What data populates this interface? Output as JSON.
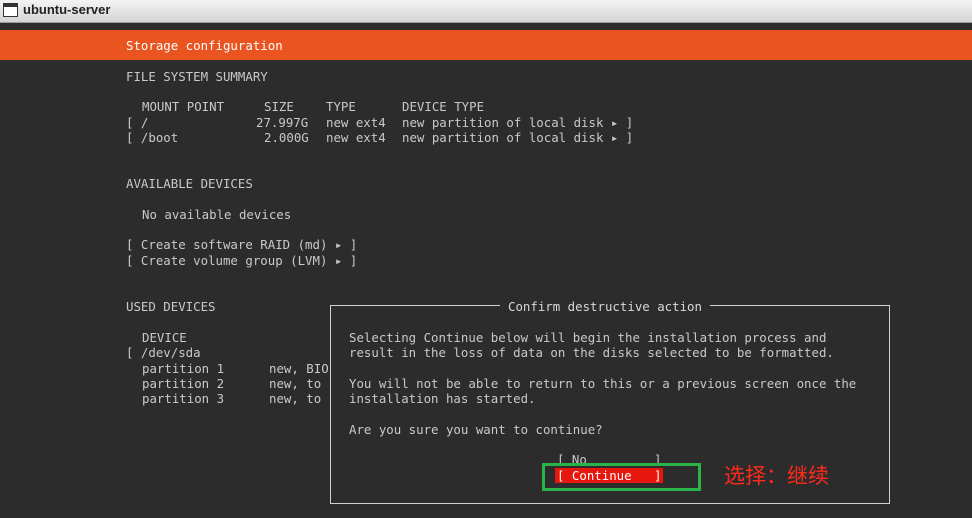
{
  "window": {
    "title": "ubuntu-server"
  },
  "header": {
    "title": "Storage configuration"
  },
  "fs_summary": {
    "heading": "FILE SYSTEM SUMMARY",
    "columns": [
      "MOUNT POINT",
      "SIZE",
      "TYPE",
      "DEVICE TYPE"
    ],
    "rows": [
      {
        "mount": "[ /",
        "size": "27.997G",
        "type": "new ext4",
        "device": "new partition of local disk ▸ ]"
      },
      {
        "mount": "[ /boot",
        "size": "2.000G",
        "type": "new ext4",
        "device": "new partition of local disk ▸ ]"
      }
    ]
  },
  "available": {
    "heading": "AVAILABLE DEVICES",
    "none": "No available devices",
    "raid": "[ Create software RAID (md) ▸ ]",
    "lvm": "[ Create volume group (LVM) ▸ ]"
  },
  "used": {
    "heading": "USED DEVICES",
    "column": "DEVICE",
    "device": "[ /dev/sda",
    "partitions": [
      {
        "name": "partition 1",
        "desc": "new, BIO"
      },
      {
        "name": "partition 2",
        "desc": "new, to"
      },
      {
        "name": "partition 3",
        "desc": "new, to"
      }
    ]
  },
  "dialog": {
    "title": "Confirm destructive action",
    "line1": "Selecting Continue below will begin the installation process and",
    "line2": "result in the loss of data on the disks selected to be formatted.",
    "line3": "You will not be able to return to this or a previous screen once the",
    "line4": "installation has started.",
    "question": "Are you sure you want to continue?",
    "no_button": "[ No         ]",
    "continue_button": "[ Continue   ]"
  },
  "annotation": {
    "text": "选择：继续",
    "box_color": "#2bb34a",
    "text_color": "#ff2a1a"
  },
  "colors": {
    "accent": "#e95420",
    "selected_button": "#e8170e"
  }
}
